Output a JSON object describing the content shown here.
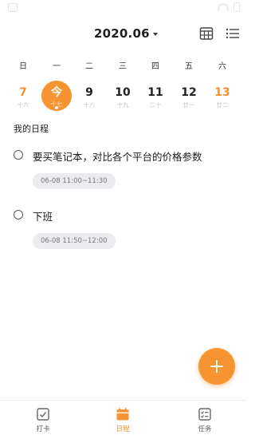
{
  "header": {
    "month": "2020.06"
  },
  "weekdays": [
    "日",
    "一",
    "二",
    "三",
    "四",
    "五",
    "六"
  ],
  "days": [
    {
      "num": "7",
      "lunar": "十六",
      "weekend": true
    },
    {
      "num": "今",
      "lunar": "十七",
      "today": true
    },
    {
      "num": "9",
      "lunar": "十八"
    },
    {
      "num": "10",
      "lunar": "十九"
    },
    {
      "num": "11",
      "lunar": "二十"
    },
    {
      "num": "12",
      "lunar": "廿一"
    },
    {
      "num": "13",
      "lunar": "廿二",
      "weekend": true
    }
  ],
  "section_title": "我的日程",
  "tasks": [
    {
      "title": "要买笔记本，对比各个平台的价格参数",
      "time": "06-08 11:00~11:30"
    },
    {
      "title": "下班",
      "time": "06-08 11:50~12:00"
    }
  ],
  "tabbar": {
    "items": [
      {
        "label": "打卡",
        "icon": "checkin-icon"
      },
      {
        "label": "日程",
        "icon": "calendar-icon",
        "active": true
      },
      {
        "label": "任务",
        "icon": "task-list-icon"
      }
    ]
  },
  "colors": {
    "accent": "#f59431",
    "weekend": "#f3902e",
    "time_chip_bg": "#ececf0"
  }
}
